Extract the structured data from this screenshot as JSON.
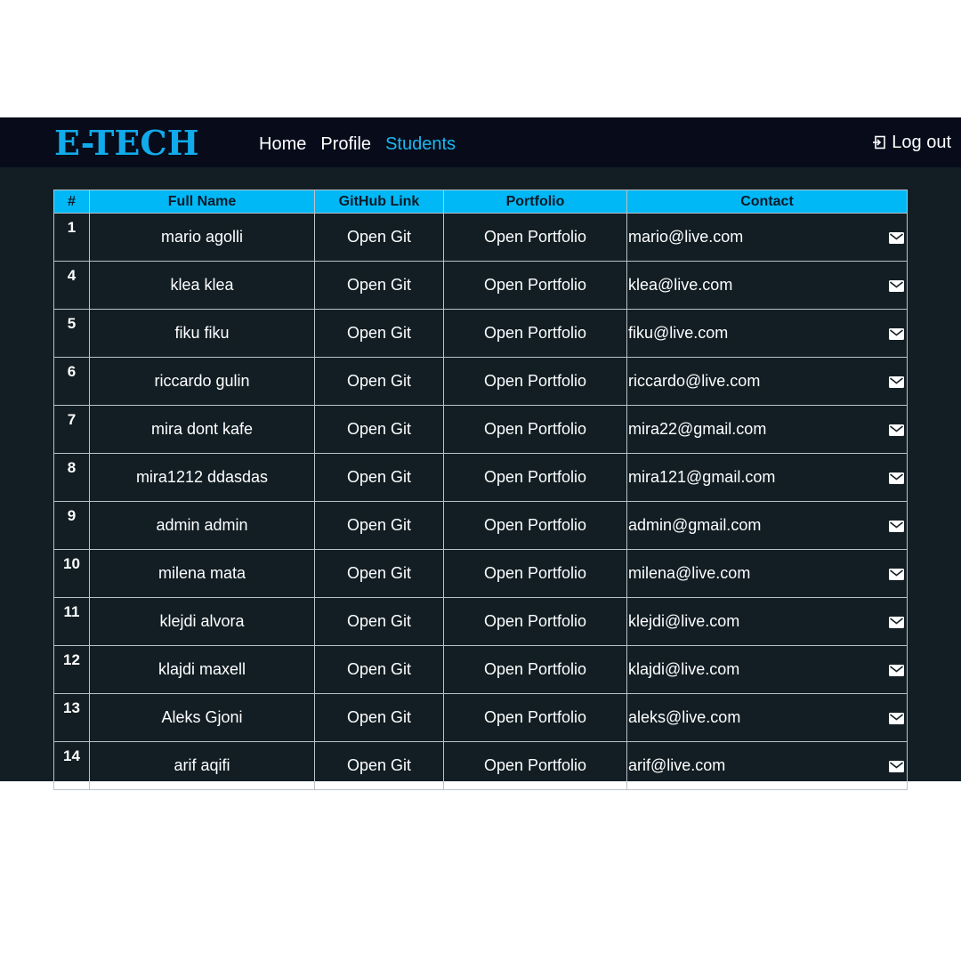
{
  "header": {
    "logo": "E-TECH",
    "nav": [
      {
        "label": "Home",
        "active": false
      },
      {
        "label": "Profile",
        "active": false
      },
      {
        "label": "Students",
        "active": true
      }
    ],
    "logout_label": "Log out",
    "logout_icon": "logout-icon"
  },
  "colors": {
    "accent": "#00b8f5",
    "navbar_bg": "#070b1a",
    "page_bg": "#121e24",
    "active_nav": "#1ab8f2"
  },
  "table": {
    "columns": [
      "#",
      "Full Name",
      "GitHub Link",
      "Portfolio",
      "Contact"
    ],
    "rows": [
      {
        "id": "1",
        "name": "mario agolli",
        "git": "Open Git",
        "portfolio": "Open Portfolio",
        "email": "mario@live.com"
      },
      {
        "id": "4",
        "name": "klea klea",
        "git": "Open Git",
        "portfolio": "Open Portfolio",
        "email": "klea@live.com"
      },
      {
        "id": "5",
        "name": "fiku fiku",
        "git": "Open Git",
        "portfolio": "Open Portfolio",
        "email": "fiku@live.com"
      },
      {
        "id": "6",
        "name": "riccardo gulin",
        "git": "Open Git",
        "portfolio": "Open Portfolio",
        "email": "riccardo@live.com"
      },
      {
        "id": "7",
        "name": "mira dont kafe",
        "git": "Open Git",
        "portfolio": "Open Portfolio",
        "email": "mira22@gmail.com"
      },
      {
        "id": "8",
        "name": "mira1212 ddasdas",
        "git": "Open Git",
        "portfolio": "Open Portfolio",
        "email": "mira121@gmail.com"
      },
      {
        "id": "9",
        "name": "admin admin",
        "git": "Open Git",
        "portfolio": "Open Portfolio",
        "email": "admin@gmail.com"
      },
      {
        "id": "10",
        "name": "milena mata",
        "git": "Open Git",
        "portfolio": "Open Portfolio",
        "email": "milena@live.com"
      },
      {
        "id": "11",
        "name": "klejdi alvora",
        "git": "Open Git",
        "portfolio": "Open Portfolio",
        "email": "klejdi@live.com"
      },
      {
        "id": "12",
        "name": "klajdi maxell",
        "git": "Open Git",
        "portfolio": "Open Portfolio",
        "email": "klajdi@live.com"
      },
      {
        "id": "13",
        "name": "Aleks Gjoni",
        "git": "Open Git",
        "portfolio": "Open Portfolio",
        "email": "aleks@live.com"
      },
      {
        "id": "14",
        "name": "arif aqifi",
        "git": "Open Git",
        "portfolio": "Open Portfolio",
        "email": "arif@live.com"
      }
    ],
    "row_icon": "mail-icon"
  }
}
